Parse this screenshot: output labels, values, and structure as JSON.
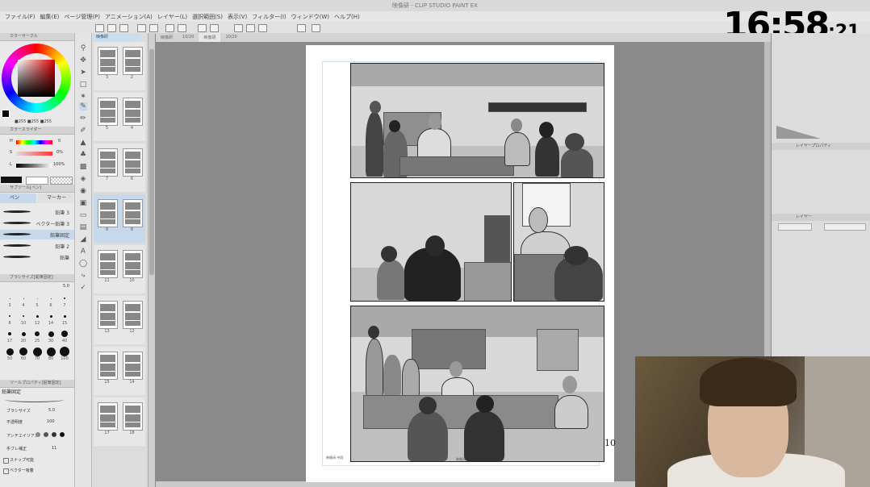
{
  "window": {
    "title": "映像研 - CLIP STUDIO PAINT EX"
  },
  "menu": [
    "ファイル(F)",
    "編集(E)",
    "ページ管理(P)",
    "アニメーション(A)",
    "レイヤー(L)",
    "選択範囲(S)",
    "表示(V)",
    "フィルター(I)",
    "ウィンドウ(W)",
    "ヘルプ(H)"
  ],
  "clock": {
    "main": "16:58",
    "seconds": ":21"
  },
  "left": {
    "color_circle_title": "カラーサークル",
    "rgb_values": "■255 ■255 ■255",
    "color_slider_title": "カラースライダー",
    "hls": [
      {
        "label": "H",
        "value": "0"
      },
      {
        "label": "S",
        "value": "0%"
      },
      {
        "label": "L",
        "value": "100%"
      }
    ],
    "subtool_title": "サブツール[ペン]",
    "subtool_tabs": [
      "ペン",
      "マーカー"
    ],
    "brushes": [
      "鉛筆 3",
      "ベクター鉛筆 3",
      "鉛筆固定",
      "鉛筆 2",
      "鉛筆"
    ],
    "brush_size_title": "ブラシサイズ[鉛筆固定]",
    "brush_size_value": "5.0",
    "size_labels": [
      "3",
      "4",
      "5",
      "6",
      "7",
      "8",
      "10",
      "12",
      "14",
      "15",
      "17",
      "20",
      "25",
      "30",
      "40",
      "50",
      "60",
      "70",
      "80",
      "100"
    ],
    "tool_property_title": "ツールプロパティ[鉛筆固定]",
    "tool_property_name": "鉛筆固定",
    "props": [
      {
        "label": "ブラシサイズ",
        "value": "5.0"
      },
      {
        "label": "不透明度",
        "value": "100"
      },
      {
        "label": "アンチエイリアス",
        "value": ""
      },
      {
        "label": "手ブレ補正",
        "value": "11"
      },
      {
        "label": "スナップ可能",
        "value": ""
      },
      {
        "label": "ベクター吸着",
        "value": ""
      }
    ]
  },
  "pages": {
    "tab": "映像研",
    "thumbs": [
      [
        "3",
        "2"
      ],
      [
        "5",
        "4"
      ],
      [
        "7",
        "6"
      ],
      [
        "9",
        "8"
      ],
      [
        "11",
        "10"
      ],
      [
        "13",
        "12"
      ],
      [
        "15",
        "14"
      ],
      [
        "17",
        "18"
      ]
    ]
  },
  "doc_tabs": [
    "映像研",
    "10/20",
    "映像研",
    "10/20"
  ],
  "canvas": {
    "page_number": "10",
    "footer_left": "映像研 中段",
    "footer_right": "映像研"
  },
  "right": {
    "layer_property_title": "レイヤープロパティ",
    "layer_title": "レイヤー"
  }
}
